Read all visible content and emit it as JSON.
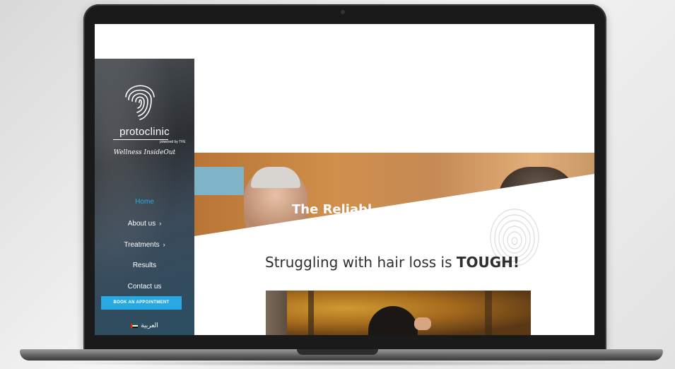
{
  "sidebar": {
    "brand_name": "protoclinic",
    "brand_sub": "powered by TFE",
    "tagline": "Wellness InsideOut",
    "nav": [
      {
        "label": "Home",
        "active": true,
        "has_submenu": false
      },
      {
        "label": "About us",
        "active": false,
        "has_submenu": true
      },
      {
        "label": "Treatments",
        "active": false,
        "has_submenu": true
      },
      {
        "label": "Results",
        "active": false,
        "has_submenu": false
      },
      {
        "label": "Contact us",
        "active": false,
        "has_submenu": false
      }
    ],
    "cta_label": "BOOK AN APPOINTMENT",
    "language_label": "العربية"
  },
  "hero": {
    "title_partial": "The Reliabl"
  },
  "content": {
    "headline_prefix": "Struggling with hair loss is",
    "headline_emphasis": "TOUGH!"
  },
  "colors": {
    "accent": "#29a9e1",
    "sidebar_dark": "#2c3034",
    "text_dark": "#2f2f2f"
  },
  "icons": {
    "logo": "fingerprint-logo-icon",
    "chevron": "chevron-right-icon",
    "flag": "uae-flag-icon",
    "watermark": "fingerprint-watermark-icon"
  }
}
